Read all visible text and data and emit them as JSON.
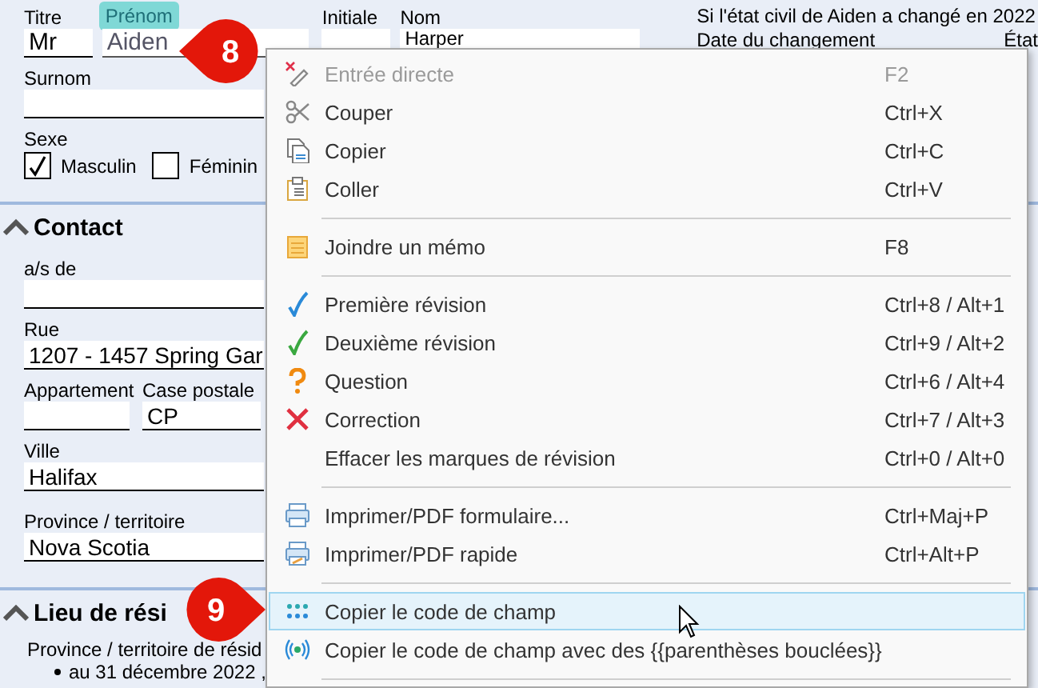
{
  "form": {
    "civil_note": "Si l'état civil de Aiden a changé en 2022",
    "name_row": [
      {
        "label": "Titre",
        "value": "Mr",
        "highlighted": false
      },
      {
        "label": "Prénom",
        "value": "Aiden",
        "highlighted": true
      },
      {
        "label": "Initiale",
        "highlighted": false
      },
      {
        "label": "Nom",
        "value": "Harper",
        "highlighted": false
      }
    ],
    "change_table": {
      "columns": [
        "Date du changement",
        "État"
      ]
    },
    "nickname": {
      "label": "Surnom"
    },
    "sex": {
      "label": "Sexe",
      "options": [
        {
          "label": "Masculin",
          "checked": true
        },
        {
          "label": "Féminin",
          "checked": false
        }
      ]
    },
    "sections": [
      {
        "title": "Contact",
        "expanded": true,
        "rows": [
          [
            {
              "label": "a/s de"
            }
          ],
          [
            {
              "label": "Rue",
              "value": "1207 - 1457 Spring Gar"
            }
          ],
          [
            {
              "label": "Appartement"
            },
            {
              "label": "Case postale",
              "value": "CP"
            }
          ],
          [
            {
              "label": "Ville",
              "value": "Halifax"
            }
          ],
          [
            {
              "label": "Province / territoire",
              "value": "Nova Scotia"
            }
          ]
        ]
      },
      {
        "title": "Lieu de rési",
        "expanded": true,
        "text": "Province / territoire de résid",
        "bullets": [
          "au 31 décembre 2022 ,"
        ]
      }
    ]
  },
  "context_menu": {
    "items": [
      {
        "kind": "item",
        "label": "Entrée directe",
        "shortcut": "F2",
        "disabled": true,
        "highlighted": false
      },
      {
        "kind": "item",
        "label": "Couper",
        "shortcut": "Ctrl+X",
        "disabled": false,
        "highlighted": false
      },
      {
        "kind": "item",
        "label": "Copier",
        "shortcut": "Ctrl+C",
        "disabled": false,
        "highlighted": false
      },
      {
        "kind": "item",
        "label": "Coller",
        "shortcut": "Ctrl+V",
        "disabled": false,
        "highlighted": false
      },
      {
        "kind": "separator"
      },
      {
        "kind": "item",
        "label": "Joindre un mémo",
        "shortcut": "F8",
        "disabled": false,
        "highlighted": false
      },
      {
        "kind": "separator"
      },
      {
        "kind": "item",
        "label": "Première révision",
        "shortcut": "Ctrl+8 / Alt+1",
        "disabled": false,
        "highlighted": false
      },
      {
        "kind": "item",
        "label": "Deuxième révision",
        "shortcut": "Ctrl+9 / Alt+2",
        "disabled": false,
        "highlighted": false
      },
      {
        "kind": "item",
        "label": "Question",
        "shortcut": "Ctrl+6 / Alt+4",
        "disabled": false,
        "highlighted": false
      },
      {
        "kind": "item",
        "label": "Correction",
        "shortcut": "Ctrl+7 / Alt+3",
        "disabled": false,
        "highlighted": false
      },
      {
        "kind": "item",
        "label": "Effacer les marques de révision",
        "shortcut": "Ctrl+0 / Alt+0",
        "disabled": false,
        "highlighted": false
      },
      {
        "kind": "separator"
      },
      {
        "kind": "item",
        "label": "Imprimer/PDF formulaire...",
        "shortcut": "Ctrl+Maj+P",
        "disabled": false,
        "highlighted": false
      },
      {
        "kind": "item",
        "label": "Imprimer/PDF rapide",
        "shortcut": "Ctrl+Alt+P",
        "disabled": false,
        "highlighted": false
      },
      {
        "kind": "separator"
      },
      {
        "kind": "item",
        "label": "Copier le code de champ",
        "disabled": false,
        "highlighted": true
      },
      {
        "kind": "item",
        "label": "Copier le code de champ avec des {{parenthèses bouclées}}",
        "disabled": false,
        "highlighted": false
      },
      {
        "kind": "separator"
      }
    ]
  },
  "callouts": [
    {
      "number": "8"
    },
    {
      "number": "9"
    }
  ]
}
